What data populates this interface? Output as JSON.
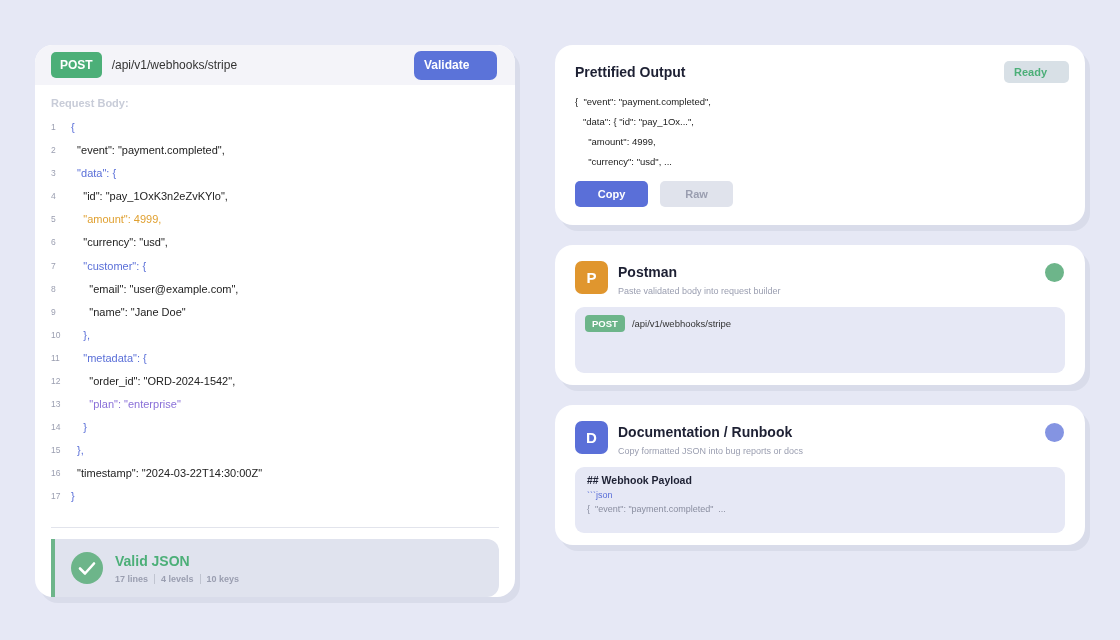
{
  "request": {
    "method": "POST",
    "path": "/api/v1/webhooks/stripe",
    "validate_button": "Validate",
    "body_label": "Request Body:",
    "lines": [
      {
        "number": "1",
        "text": "{",
        "kind": "key"
      },
      {
        "number": "2",
        "text": "  \"event\": \"payment.completed\",",
        "kind": "plain"
      },
      {
        "number": "3",
        "text": "  \"data\": {",
        "kind": "key"
      },
      {
        "number": "4",
        "text": "    \"id\": \"pay_1OxK3n2eZvKYlo\",",
        "kind": "plain"
      },
      {
        "number": "5",
        "text": "    \"amount\": 4999,",
        "kind": "warn"
      },
      {
        "number": "6",
        "text": "    \"currency\": \"usd\",",
        "kind": "plain"
      },
      {
        "number": "7",
        "text": "    \"customer\": {",
        "kind": "key"
      },
      {
        "number": "8",
        "text": "      \"email\": \"user@example.com\",",
        "kind": "plain"
      },
      {
        "number": "9",
        "text": "      \"name\": \"Jane Doe\"",
        "kind": "plain"
      },
      {
        "number": "10",
        "text": "    },",
        "kind": "key"
      },
      {
        "number": "11",
        "text": "    \"metadata\": {",
        "kind": "key"
      },
      {
        "number": "12",
        "text": "      \"order_id\": \"ORD-2024-1542\",",
        "kind": "plain"
      },
      {
        "number": "13",
        "text": "      \"plan\": \"enterprise\"",
        "kind": "accent"
      },
      {
        "number": "14",
        "text": "    }",
        "kind": "key"
      },
      {
        "number": "15",
        "text": "  },",
        "kind": "key"
      },
      {
        "number": "16",
        "text": "  \"timestamp\": \"2024-03-22T14:30:00Z\"",
        "kind": "plain"
      },
      {
        "number": "17",
        "text": "}",
        "kind": "key"
      }
    ],
    "result": {
      "valid": true,
      "title": "Valid JSON",
      "stats": [
        "17 lines",
        "4 levels",
        "10 keys"
      ]
    }
  },
  "output": {
    "title": "Prettified Output",
    "status": "Ready",
    "lines": [
      "{  \"event\": \"payment.completed\",",
      "   \"data\": { \"id\": \"pay_1Ox...\",",
      "     \"amount\": 4999,",
      "     \"currency\": \"usd\", ..."
    ],
    "buttons": [
      {
        "label": "Copy",
        "disabled": false
      },
      {
        "label": "Raw",
        "disabled": true
      }
    ]
  },
  "integrations": [
    {
      "badge": {
        "letter": "P",
        "color": "#e0962e"
      },
      "title": "Postman",
      "subtitle": "Paste validated body into request builder",
      "status_dot": {
        "color": "#6db58a"
      },
      "kind": "request",
      "method": "POST",
      "path": "/api/v1/webhooks/stripe"
    },
    {
      "badge": {
        "letter": "D",
        "color": "#5a6fd8"
      },
      "title": "Documentation / Runbook",
      "subtitle": "Copy formatted JSON into bug reports or docs",
      "status_dot": {
        "color": "#8494e2"
      },
      "kind": "markdown",
      "heading": "## Webhook Payload",
      "fence": "```json",
      "preview": "{  \"event\": \"payment.completed\"  ..."
    }
  ]
}
